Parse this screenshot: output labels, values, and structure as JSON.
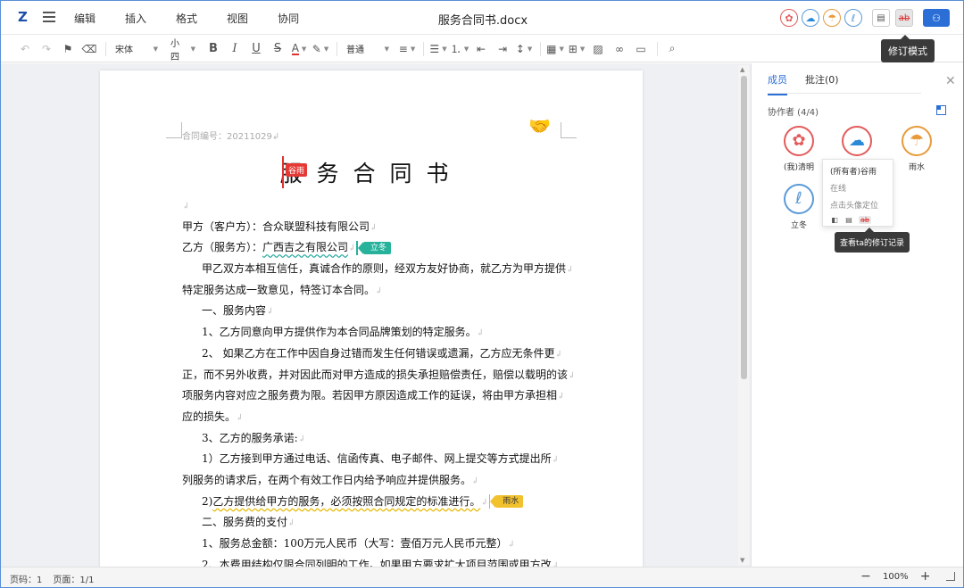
{
  "app": {
    "logo": "Z",
    "doc_title": "服务合同书.docx"
  },
  "menu": [
    "编辑",
    "插入",
    "格式",
    "视图",
    "协同"
  ],
  "top_right": {
    "revision_tooltip": "修订模式",
    "revision_icon_text": "ab"
  },
  "toolbar": {
    "font_family": "宋体",
    "font_size": "小四",
    "bold": "B",
    "italic": "I",
    "underline": "U",
    "strike": "S",
    "font_color": "A",
    "style": "普通"
  },
  "document": {
    "contract_no": "合同编号：20211029",
    "heading": "服务合同书",
    "cursor_label": "谷雨",
    "lines": [
      {
        "text": "",
        "indent": false
      },
      {
        "text": "甲方（客户方）：合众联盟科技有限公司",
        "indent": false
      },
      {
        "text": "乙方（服务方）：",
        "highlight": "广西吉之有限公司",
        "flag": "立冬",
        "flag_color": "green",
        "indent": false
      },
      {
        "text": "甲乙双方本相互信任，真诚合作的原则，经双方友好协商，就乙方为甲方提供",
        "indent": true
      },
      {
        "text": "特定服务达成一致意见，特签订本合同。",
        "indent": false
      },
      {
        "text": "一、服务内容",
        "indent": true
      },
      {
        "text": "1、乙方同意向甲方提供作为本合同品牌策划的特定服务。",
        "indent": true
      },
      {
        "text": "2、 如果乙方在工作中因自身过错而发生任何错误或遗漏，乙方应无条件更",
        "indent": true
      },
      {
        "text": "正，而不另外收费，并对因此而对甲方造成的损失承担赔偿责任，赔偿以载明的该",
        "indent": false
      },
      {
        "text": "项服务内容对应之服务费为限。若因甲方原因造成工作的延误，将由甲方承担相",
        "indent": false
      },
      {
        "text": "应的损失。",
        "indent": false
      },
      {
        "text": "3、乙方的服务承诺:",
        "indent": true
      },
      {
        "text": "1）乙方接到甲方通过电话、信函传真、电子邮件、网上提交等方式提出所",
        "indent": true
      },
      {
        "text": "列服务的请求后，在两个有效工作日内给予响应并提供服务。",
        "indent": false
      },
      {
        "text": "2)",
        "highlight2": "乙方提供给甲方的服务，必须按照合同规定的标准进行。",
        "flag": "雨水",
        "flag_color": "yellow",
        "indent": true
      },
      {
        "text": "二、服务费的支付",
        "indent": true
      },
      {
        "text": "1、服务总金额：100万元人民币（大写：壹佰万元人民币元整）",
        "indent": true
      },
      {
        "text": "2、本费用结构仅限合同列明的工作。如果甲方要求扩大项目范围或甲方改",
        "indent": true
      }
    ]
  },
  "panel": {
    "tabs": [
      "成员",
      "批注(0)"
    ],
    "collab_header": "协作者 (4/4)",
    "members": [
      {
        "name": "(我)清明",
        "icon": "flower-icon",
        "glyph": "✿",
        "color": "red"
      },
      {
        "name": "(所有者)谷雨",
        "icon": "cloud-rain-icon",
        "glyph": "☁",
        "color": "red"
      },
      {
        "name": "雨水",
        "icon": "umbrella-icon",
        "glyph": "☂",
        "color": "orange"
      },
      {
        "name": "立冬",
        "icon": "thermometer-icon",
        "glyph": "🌡",
        "color": "blue"
      }
    ],
    "popup": {
      "name": "(所有者)谷雨",
      "status": "在线",
      "hint": "点击头像定位"
    },
    "tooltip": "查看ta的修订记录"
  },
  "status": {
    "page_code": "页码：1",
    "pages": "页面：1/1",
    "zoom": "100%"
  }
}
